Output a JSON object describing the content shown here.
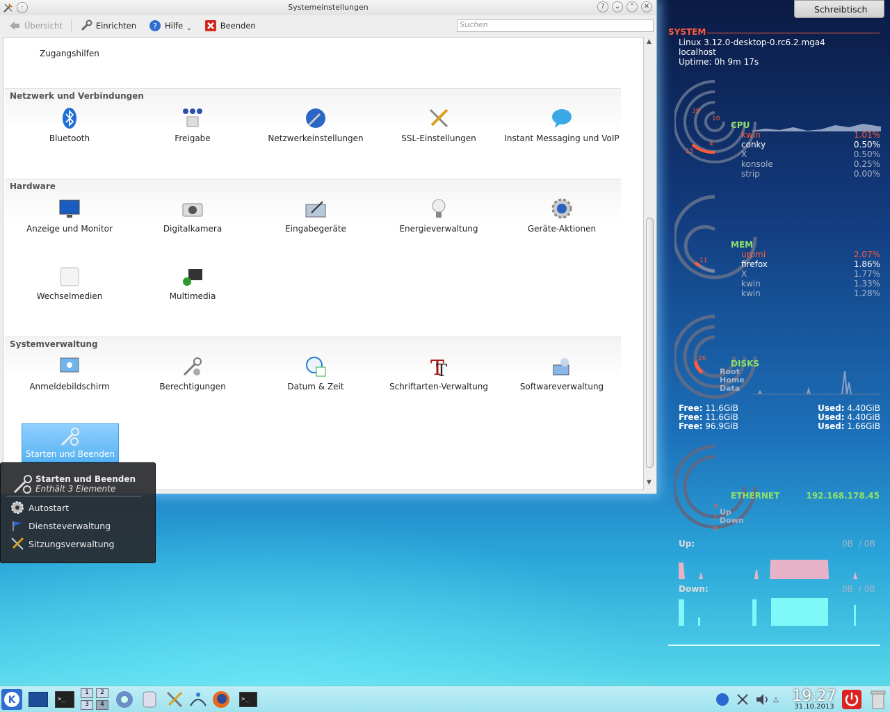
{
  "window": {
    "title": "Systemeinstellungen",
    "controls": [
      "?",
      "⌄",
      "⌃",
      "✕"
    ]
  },
  "toolbar": {
    "overview": "Übersicht",
    "configure": "Einrichten",
    "help": "Hilfe",
    "quit": "Beenden",
    "search_placeholder": "Suchen"
  },
  "top_item": "Zugangshilfen",
  "sections": [
    {
      "title": "Netzwerk und Verbindungen",
      "items": [
        "Bluetooth",
        "Freigabe",
        "Netzwerkeinstellungen",
        "SSL-Einstellungen",
        "Instant Messaging und VoIP"
      ]
    },
    {
      "title": "Hardware",
      "items": [
        "Anzeige und Monitor",
        "Digitalkamera",
        "Eingabegeräte",
        "Energieverwaltung",
        "Geräte-Aktionen",
        "Wechselmedien",
        "Multimedia"
      ]
    },
    {
      "title": "Systemverwaltung",
      "items": [
        "Anmeldebildschirm",
        "Berechtigungen",
        "Datum & Zeit",
        "Schriftarten-Verwaltung",
        "Softwareverwaltung",
        "Starten und Beenden"
      ]
    }
  ],
  "popup": {
    "title": "Starten und Beenden",
    "subtitle": "Enthält 3 Elemente",
    "items": [
      "Autostart",
      "Diensteverwaltung",
      "Sitzungsverwaltung"
    ]
  },
  "desktop_button": "Schreibtisch",
  "conky": {
    "system_label": "SYSTEM",
    "kernel": "Linux 3.12.0-desktop-0.rc6.2.mga4",
    "host": "localhost",
    "uptime": "Uptime: 0h 9m 17s",
    "cpu_label": "CPU",
    "cpu_ring_labels": [
      "39",
      "10",
      "4",
      "15"
    ],
    "cpu_procs": [
      {
        "name": "kwin",
        "val": "1.01%"
      },
      {
        "name": "conky",
        "val": "0.50%"
      },
      {
        "name": "X",
        "val": "0.50%"
      },
      {
        "name": "konsole",
        "val": "0.25%"
      },
      {
        "name": "strip",
        "val": "0.00%"
      }
    ],
    "mem_label": "MEM",
    "mem_ring_label": "11",
    "mem_procs": [
      {
        "name": "urpmi",
        "val": "2.07%"
      },
      {
        "name": "firefox",
        "val": "1.86%"
      },
      {
        "name": "X",
        "val": "1.77%"
      },
      {
        "name": "kwin",
        "val": "1.33%"
      },
      {
        "name": "kwin",
        "val": "1.28%"
      }
    ],
    "disks_label": "DISKS",
    "disk_ring_labels": [
      "26",
      "2"
    ],
    "disk_names": [
      "Root",
      "Home",
      "Data"
    ],
    "disks": [
      {
        "free": "11.6GiB",
        "used": "4.40GiB"
      },
      {
        "free": "11.6GiB",
        "used": "4.40GiB"
      },
      {
        "free": "96.9GiB",
        "used": "1.66GiB"
      }
    ],
    "free_label": "Free:",
    "used_label": "Used:",
    "eth_label": "ETHERNET",
    "ip": "192.168.178.45",
    "eth_ring_labels": [
      "0",
      "1",
      "0"
    ],
    "eth_up": "Up",
    "eth_down": "Down",
    "up_label": "Up:",
    "up_val": "0B",
    "up_total": "/ 0B",
    "down_label": "Down:",
    "down_val": "0B",
    "down_total": "/ 0B"
  },
  "clock": {
    "time": "19:27",
    "date": "31.10.2013"
  },
  "pager": [
    "1",
    "2",
    "3",
    "4"
  ]
}
